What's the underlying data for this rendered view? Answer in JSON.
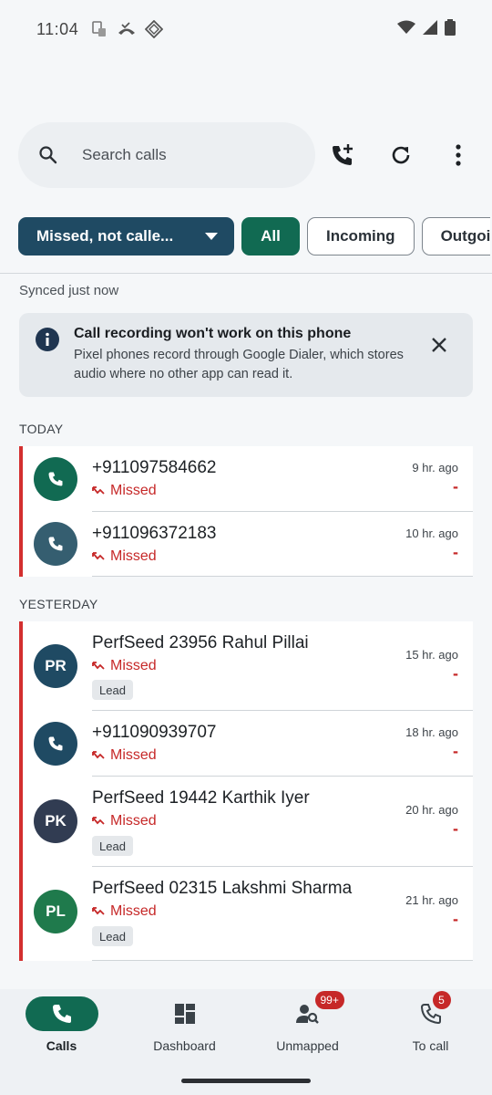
{
  "status_bar": {
    "time": "11:04",
    "icons": [
      "sim-icon",
      "missed-call-icon",
      "data-saver-icon",
      "wifi-icon",
      "signal-icon",
      "battery-icon"
    ]
  },
  "search": {
    "placeholder": "Search calls"
  },
  "toolbar_icons": [
    "add-call-icon",
    "refresh-icon",
    "more-vert-icon"
  ],
  "filters": {
    "dropdown_label": "Missed, not calle...",
    "chips": [
      "All",
      "Incoming",
      "Outgoi"
    ],
    "active_chip": "All"
  },
  "sync_status": "Synced just now",
  "banner": {
    "title": "Call recording won't work on this phone",
    "body": "Pixel phones record through Google Dialer, which stores audio where no other app can read it."
  },
  "sections": {
    "today": "TODAY",
    "yesterday": "YESTERDAY"
  },
  "calls": [
    {
      "name": "+911097584662",
      "status": "Missed",
      "time": "9 hr. ago",
      "duration": "-",
      "avatar_type": "phone",
      "avatar_color": "#116a52",
      "tag": ""
    },
    {
      "name": "+911096372183",
      "status": "Missed",
      "time": "10 hr. ago",
      "duration": "-",
      "avatar_type": "phone",
      "avatar_color": "#355e70",
      "tag": ""
    },
    {
      "name": "PerfSeed 23956 Rahul Pillai",
      "status": "Missed",
      "time": "15 hr. ago",
      "duration": "-",
      "avatar_type": "initials",
      "initials": "PR",
      "avatar_color": "#1f4a63",
      "tag": "Lead"
    },
    {
      "name": "+911090939707",
      "status": "Missed",
      "time": "18 hr. ago",
      "duration": "-",
      "avatar_type": "phone",
      "avatar_color": "#1f4a63",
      "tag": ""
    },
    {
      "name": "PerfSeed 19442 Karthik Iyer",
      "status": "Missed",
      "time": "20 hr. ago",
      "duration": "-",
      "avatar_type": "initials",
      "initials": "PK",
      "avatar_color": "#313c52",
      "tag": "Lead"
    },
    {
      "name": "PerfSeed 02315 Lakshmi Sharma",
      "status": "Missed",
      "time": "21 hr. ago",
      "duration": "-",
      "avatar_type": "initials",
      "initials": "PL",
      "avatar_color": "#1f7a4c",
      "tag": "Lead"
    }
  ],
  "bottom_nav": [
    {
      "label": "Calls",
      "icon": "phone-icon",
      "active": true,
      "badge": ""
    },
    {
      "label": "Dashboard",
      "icon": "dashboard-icon",
      "active": false,
      "badge": ""
    },
    {
      "label": "Unmapped",
      "icon": "person-search-icon",
      "active": false,
      "badge": "99+"
    },
    {
      "label": "To call",
      "icon": "phone-callback-icon",
      "active": false,
      "badge": "5"
    }
  ],
  "colors": {
    "primary": "#116a52",
    "dropdown": "#1f4a63",
    "missed": "#c62828",
    "accent_bar": "#d32f2f"
  }
}
